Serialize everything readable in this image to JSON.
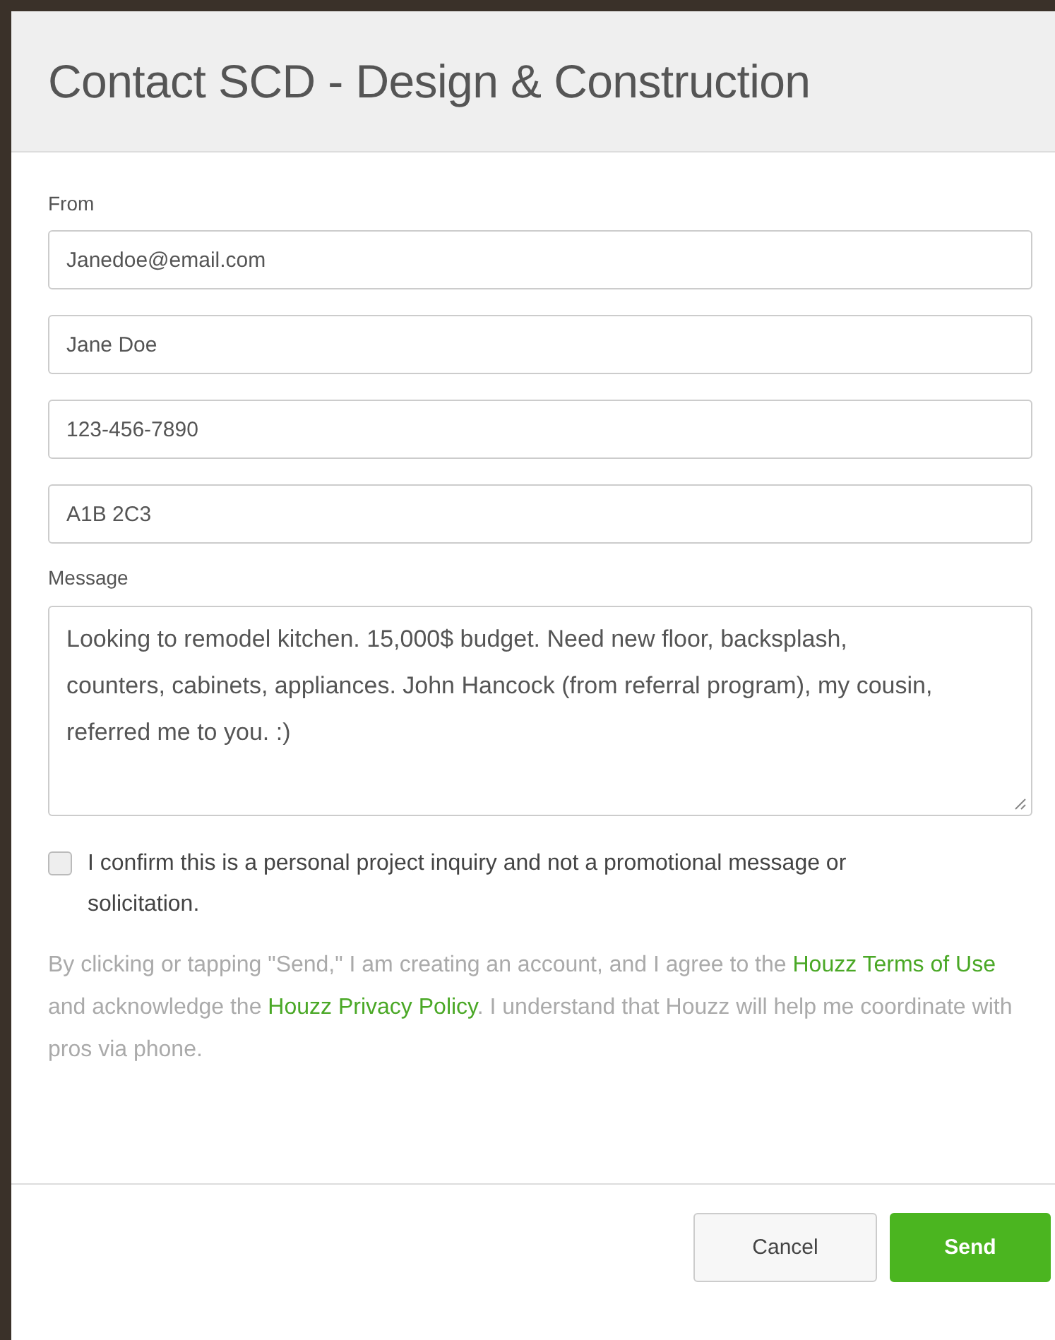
{
  "dialog": {
    "title": "Contact SCD - Design & Construction"
  },
  "from": {
    "label": "From",
    "fields": [
      {
        "value": "Janedoe@email.com"
      },
      {
        "value": "Jane Doe"
      },
      {
        "value": "123-456-7890"
      },
      {
        "value": "A1B 2C3"
      }
    ]
  },
  "message": {
    "label": "Message",
    "value": "Looking to remodel kitchen. 15,000$ budget. Need new floor, backsplash, counters, cabinets, appliances. John Hancock (from referral program), my cousin, referred me to you. :)"
  },
  "confirm": {
    "label": "I confirm this is a personal project inquiry and not a promotional message or solicitation.",
    "checked": false
  },
  "notice": [
    {
      "kind": "text",
      "text": "By clicking or tapping \"Send,\" I am creating an account, and I agree to the "
    },
    {
      "kind": "link",
      "text": "Houzz Terms of Use"
    },
    {
      "kind": "text",
      "text": " and acknowledge the "
    },
    {
      "kind": "link",
      "text": "Houzz Privacy Policy"
    },
    {
      "kind": "text",
      "text": ". I understand that Houzz will help me coordinate with pros via phone."
    }
  ],
  "buttons": [
    {
      "label": "Cancel",
      "kind": "secondary"
    },
    {
      "label": "Send",
      "kind": "primary"
    }
  ]
}
